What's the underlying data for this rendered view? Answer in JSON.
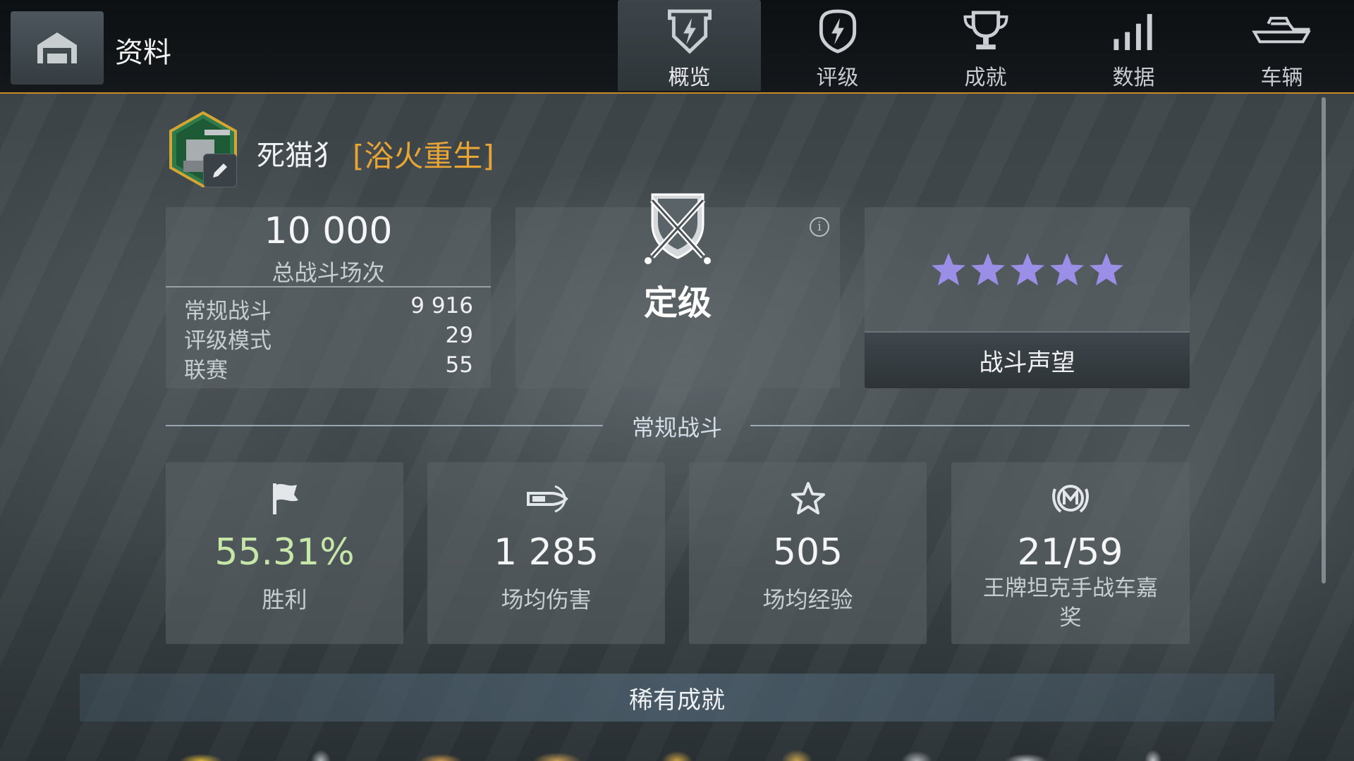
{
  "header": {
    "title": "资料",
    "tabs": [
      {
        "label": "概览",
        "icon": "shield-bolt-icon",
        "active": true
      },
      {
        "label": "评级",
        "icon": "bolt-badge-icon",
        "active": false
      },
      {
        "label": "成就",
        "icon": "trophy-icon",
        "active": false
      },
      {
        "label": "数据",
        "icon": "bar-signal-icon",
        "active": false
      },
      {
        "label": "车辆",
        "icon": "tank-icon",
        "active": false
      }
    ],
    "accent_color": "#c98a25"
  },
  "player": {
    "name": "死猫犭",
    "clan": "[浴火重生]",
    "clan_color": "#e8a435"
  },
  "battles": {
    "total": "10 000",
    "total_label": "总战斗场次",
    "rows": [
      {
        "label": "常规战斗",
        "value": "9 916"
      },
      {
        "label": "评级模式",
        "value": "29"
      },
      {
        "label": "联赛",
        "value": "55"
      }
    ]
  },
  "rating": {
    "label": "定级"
  },
  "reputation": {
    "stars": 5,
    "star_color": "#9a8ee6",
    "button_label": "战斗声望"
  },
  "section": {
    "title": "常规战斗"
  },
  "stats": [
    {
      "icon": "flag-icon",
      "value": "55.31%",
      "caption": "胜利",
      "value_color": "#c6e7a8"
    },
    {
      "icon": "shell-icon",
      "value": "1 285",
      "caption": "场均伤害"
    },
    {
      "icon": "star-outline-icon",
      "value": "505",
      "caption": "场均经验"
    },
    {
      "icon": "mastery-badge-icon",
      "value": "21/59",
      "caption": "王牌坦克手战车嘉奖"
    }
  ],
  "rare": {
    "title": "稀有成就"
  }
}
